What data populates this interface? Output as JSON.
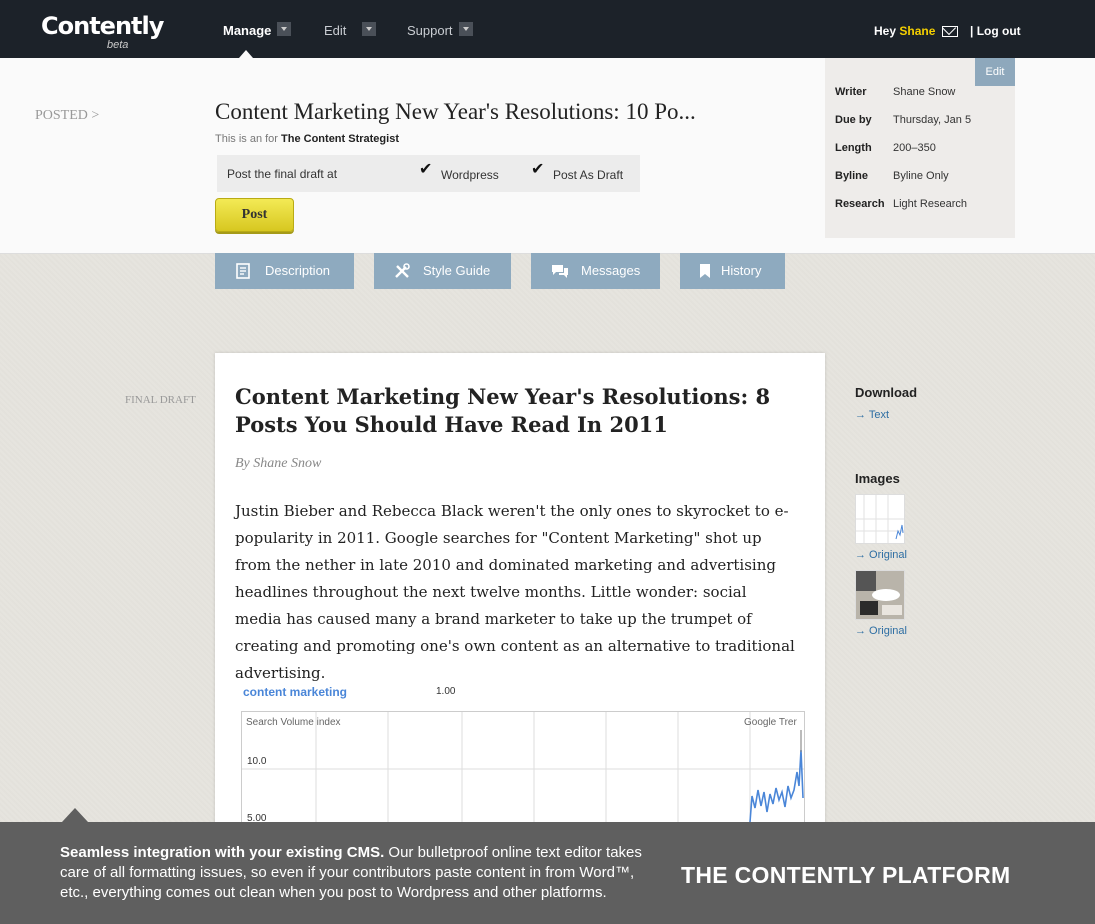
{
  "nav": {
    "logo": "Contently",
    "logo_sub": "beta",
    "items": [
      "Manage",
      "Edit",
      "Support"
    ],
    "greeting": "Hey",
    "user": "Shane",
    "logout": "| Log out"
  },
  "header": {
    "status": "POSTED >",
    "title": "Content Marketing New Year's Resolutions: 10 Po...",
    "subtitle_prefix": "This is an for",
    "client": "The Content Strategist",
    "post_label": "Post the final draft at",
    "option_wordpress": "Wordpress",
    "option_draft": "Post As Draft",
    "post_button": "Post"
  },
  "meta": {
    "edit": "Edit",
    "rows": [
      {
        "k": "Writer",
        "v": "Shane Snow"
      },
      {
        "k": "Due by",
        "v": "Thursday, Jan 5"
      },
      {
        "k": "Length",
        "v": "200–350"
      },
      {
        "k": "Byline",
        "v": "Byline Only"
      },
      {
        "k": "Research",
        "v": "Light Research"
      }
    ]
  },
  "tabs": [
    "Description",
    "Style Guide",
    "Messages",
    "History"
  ],
  "doc": {
    "label": "FINAL DRAFT",
    "title": "Content Marketing New Year's Resolutions: 8 Posts You Should Have Read In 2011",
    "byline": "By Shane Snow",
    "body": "Justin Bieber and Rebecca Black weren't the only ones to skyrocket to e-popularity in 2011. Google searches for \"Content Marketing\" shot up from the nether in late 2010 and dominated marketing and advertising headlines throughout the next twelve months. Little wonder: social media has caused many a brand marketer to take up the trumpet of creating and promoting one's own content as an alternative to traditional advertising.",
    "chart": {
      "legend": "content marketing",
      "legend_value": "1.00",
      "y_title": "Search Volume index",
      "source": "Google Trer",
      "y_ticks": [
        "10.0",
        "5.00"
      ]
    }
  },
  "side": {
    "download_head": "Download",
    "download_link": "→ Text",
    "images_head": "Images",
    "original_1": "→ Original",
    "original_2": "→ Original"
  },
  "banner": {
    "bold": "Seamless integration with your existing CMS.",
    "text": " Our bulletproof online text editor takes care of all formatting issues, so even if your contributors paste content in from Word™, etc., everything comes out clean when you post to Wordpress and other platforms.",
    "headline": "THE CONTENTLY PLATFORM"
  },
  "colors": {
    "nav_bg": "#1c2229",
    "tab_bg": "#8eaabf",
    "post_button": "#e8dc3a",
    "link": "#2e6ea3",
    "chart_line": "#4a86d8"
  }
}
